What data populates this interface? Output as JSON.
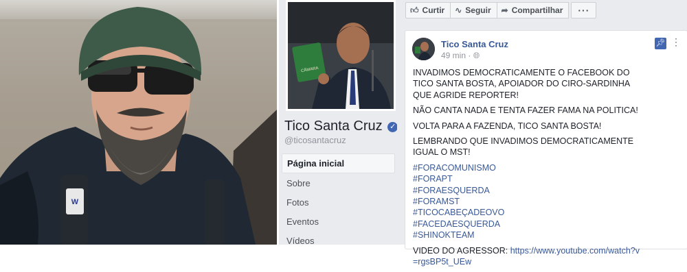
{
  "profile": {
    "name": "Tico Santa Cruz",
    "verified_mark": "✓",
    "handle": "@ticosantacruz",
    "nav": [
      "Página inicial",
      "Sobre",
      "Fotos",
      "Eventos",
      "Vídeos"
    ],
    "active_nav": "Página inicial",
    "book_title": "CÂMARA"
  },
  "actions": {
    "like": "Curtir",
    "follow": "Seguir",
    "share": "Compartilhar",
    "more": "···",
    "icons": [
      "thumbs-up-icon",
      "rss-icon",
      "share-arrow-icon",
      "more-icon"
    ]
  },
  "post": {
    "author": "Tico Santa Cruz",
    "time": "49 min",
    "separator": "·",
    "paragraphs": [
      "INVADIMOS DEMOCRATICAMENTE O FACEBOOK DO TICO SANTA BOSTA, APOIADOR DO CIRO-SARDINHA QUE AGRIDE REPORTER!",
      "NÃO CANTA NADA E TENTA FAZER FAMA NA POLITICA!",
      "VOLTA PARA A FAZENDA, TICO SANTA BOSTA!",
      "LEMBRANDO QUE INVADIMOS DEMOCRATICAMENTE IGUAL O MST!"
    ],
    "hashtags": [
      "#FORACOMUNISMO",
      "#FORAPT",
      "#FORAESQUERDA",
      "#FORAMST",
      "#TICOCABEÇADEOVO",
      "#FACEDAESQUERDA",
      "#SHINOKTEAM"
    ],
    "video_label": "VIDEO DO AGRESSOR:",
    "video_url": "https://www.youtube.com/watch?v=rgsBP5t_UEw"
  },
  "colors": {
    "fb_blue": "#4267b2",
    "link": "#385898",
    "page_bg": "#e9ebee"
  }
}
